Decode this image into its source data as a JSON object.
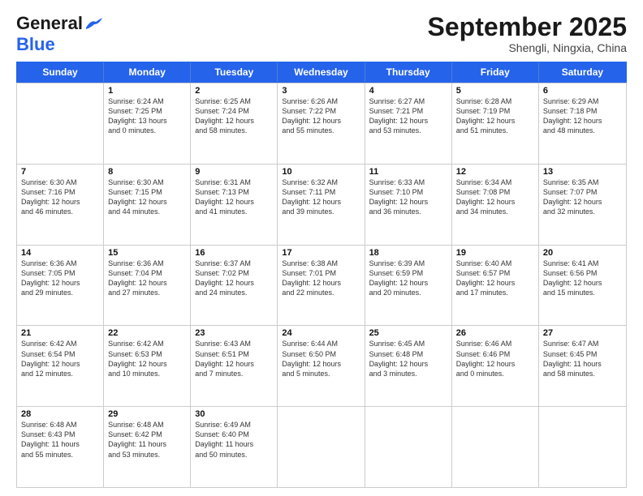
{
  "logo": {
    "text_general": "General",
    "text_blue": "Blue"
  },
  "title": "September 2025",
  "subtitle": "Shengli, Ningxia, China",
  "header_days": [
    "Sunday",
    "Monday",
    "Tuesday",
    "Wednesday",
    "Thursday",
    "Friday",
    "Saturday"
  ],
  "weeks": [
    [
      {
        "day": "",
        "lines": []
      },
      {
        "day": "1",
        "lines": [
          "Sunrise: 6:24 AM",
          "Sunset: 7:25 PM",
          "Daylight: 13 hours",
          "and 0 minutes."
        ]
      },
      {
        "day": "2",
        "lines": [
          "Sunrise: 6:25 AM",
          "Sunset: 7:24 PM",
          "Daylight: 12 hours",
          "and 58 minutes."
        ]
      },
      {
        "day": "3",
        "lines": [
          "Sunrise: 6:26 AM",
          "Sunset: 7:22 PM",
          "Daylight: 12 hours",
          "and 55 minutes."
        ]
      },
      {
        "day": "4",
        "lines": [
          "Sunrise: 6:27 AM",
          "Sunset: 7:21 PM",
          "Daylight: 12 hours",
          "and 53 minutes."
        ]
      },
      {
        "day": "5",
        "lines": [
          "Sunrise: 6:28 AM",
          "Sunset: 7:19 PM",
          "Daylight: 12 hours",
          "and 51 minutes."
        ]
      },
      {
        "day": "6",
        "lines": [
          "Sunrise: 6:29 AM",
          "Sunset: 7:18 PM",
          "Daylight: 12 hours",
          "and 48 minutes."
        ]
      }
    ],
    [
      {
        "day": "7",
        "lines": [
          "Sunrise: 6:30 AM",
          "Sunset: 7:16 PM",
          "Daylight: 12 hours",
          "and 46 minutes."
        ]
      },
      {
        "day": "8",
        "lines": [
          "Sunrise: 6:30 AM",
          "Sunset: 7:15 PM",
          "Daylight: 12 hours",
          "and 44 minutes."
        ]
      },
      {
        "day": "9",
        "lines": [
          "Sunrise: 6:31 AM",
          "Sunset: 7:13 PM",
          "Daylight: 12 hours",
          "and 41 minutes."
        ]
      },
      {
        "day": "10",
        "lines": [
          "Sunrise: 6:32 AM",
          "Sunset: 7:11 PM",
          "Daylight: 12 hours",
          "and 39 minutes."
        ]
      },
      {
        "day": "11",
        "lines": [
          "Sunrise: 6:33 AM",
          "Sunset: 7:10 PM",
          "Daylight: 12 hours",
          "and 36 minutes."
        ]
      },
      {
        "day": "12",
        "lines": [
          "Sunrise: 6:34 AM",
          "Sunset: 7:08 PM",
          "Daylight: 12 hours",
          "and 34 minutes."
        ]
      },
      {
        "day": "13",
        "lines": [
          "Sunrise: 6:35 AM",
          "Sunset: 7:07 PM",
          "Daylight: 12 hours",
          "and 32 minutes."
        ]
      }
    ],
    [
      {
        "day": "14",
        "lines": [
          "Sunrise: 6:36 AM",
          "Sunset: 7:05 PM",
          "Daylight: 12 hours",
          "and 29 minutes."
        ]
      },
      {
        "day": "15",
        "lines": [
          "Sunrise: 6:36 AM",
          "Sunset: 7:04 PM",
          "Daylight: 12 hours",
          "and 27 minutes."
        ]
      },
      {
        "day": "16",
        "lines": [
          "Sunrise: 6:37 AM",
          "Sunset: 7:02 PM",
          "Daylight: 12 hours",
          "and 24 minutes."
        ]
      },
      {
        "day": "17",
        "lines": [
          "Sunrise: 6:38 AM",
          "Sunset: 7:01 PM",
          "Daylight: 12 hours",
          "and 22 minutes."
        ]
      },
      {
        "day": "18",
        "lines": [
          "Sunrise: 6:39 AM",
          "Sunset: 6:59 PM",
          "Daylight: 12 hours",
          "and 20 minutes."
        ]
      },
      {
        "day": "19",
        "lines": [
          "Sunrise: 6:40 AM",
          "Sunset: 6:57 PM",
          "Daylight: 12 hours",
          "and 17 minutes."
        ]
      },
      {
        "day": "20",
        "lines": [
          "Sunrise: 6:41 AM",
          "Sunset: 6:56 PM",
          "Daylight: 12 hours",
          "and 15 minutes."
        ]
      }
    ],
    [
      {
        "day": "21",
        "lines": [
          "Sunrise: 6:42 AM",
          "Sunset: 6:54 PM",
          "Daylight: 12 hours",
          "and 12 minutes."
        ]
      },
      {
        "day": "22",
        "lines": [
          "Sunrise: 6:42 AM",
          "Sunset: 6:53 PM",
          "Daylight: 12 hours",
          "and 10 minutes."
        ]
      },
      {
        "day": "23",
        "lines": [
          "Sunrise: 6:43 AM",
          "Sunset: 6:51 PM",
          "Daylight: 12 hours",
          "and 7 minutes."
        ]
      },
      {
        "day": "24",
        "lines": [
          "Sunrise: 6:44 AM",
          "Sunset: 6:50 PM",
          "Daylight: 12 hours",
          "and 5 minutes."
        ]
      },
      {
        "day": "25",
        "lines": [
          "Sunrise: 6:45 AM",
          "Sunset: 6:48 PM",
          "Daylight: 12 hours",
          "and 3 minutes."
        ]
      },
      {
        "day": "26",
        "lines": [
          "Sunrise: 6:46 AM",
          "Sunset: 6:46 PM",
          "Daylight: 12 hours",
          "and 0 minutes."
        ]
      },
      {
        "day": "27",
        "lines": [
          "Sunrise: 6:47 AM",
          "Sunset: 6:45 PM",
          "Daylight: 11 hours",
          "and 58 minutes."
        ]
      }
    ],
    [
      {
        "day": "28",
        "lines": [
          "Sunrise: 6:48 AM",
          "Sunset: 6:43 PM",
          "Daylight: 11 hours",
          "and 55 minutes."
        ]
      },
      {
        "day": "29",
        "lines": [
          "Sunrise: 6:48 AM",
          "Sunset: 6:42 PM",
          "Daylight: 11 hours",
          "and 53 minutes."
        ]
      },
      {
        "day": "30",
        "lines": [
          "Sunrise: 6:49 AM",
          "Sunset: 6:40 PM",
          "Daylight: 11 hours",
          "and 50 minutes."
        ]
      },
      {
        "day": "",
        "lines": []
      },
      {
        "day": "",
        "lines": []
      },
      {
        "day": "",
        "lines": []
      },
      {
        "day": "",
        "lines": []
      }
    ]
  ]
}
